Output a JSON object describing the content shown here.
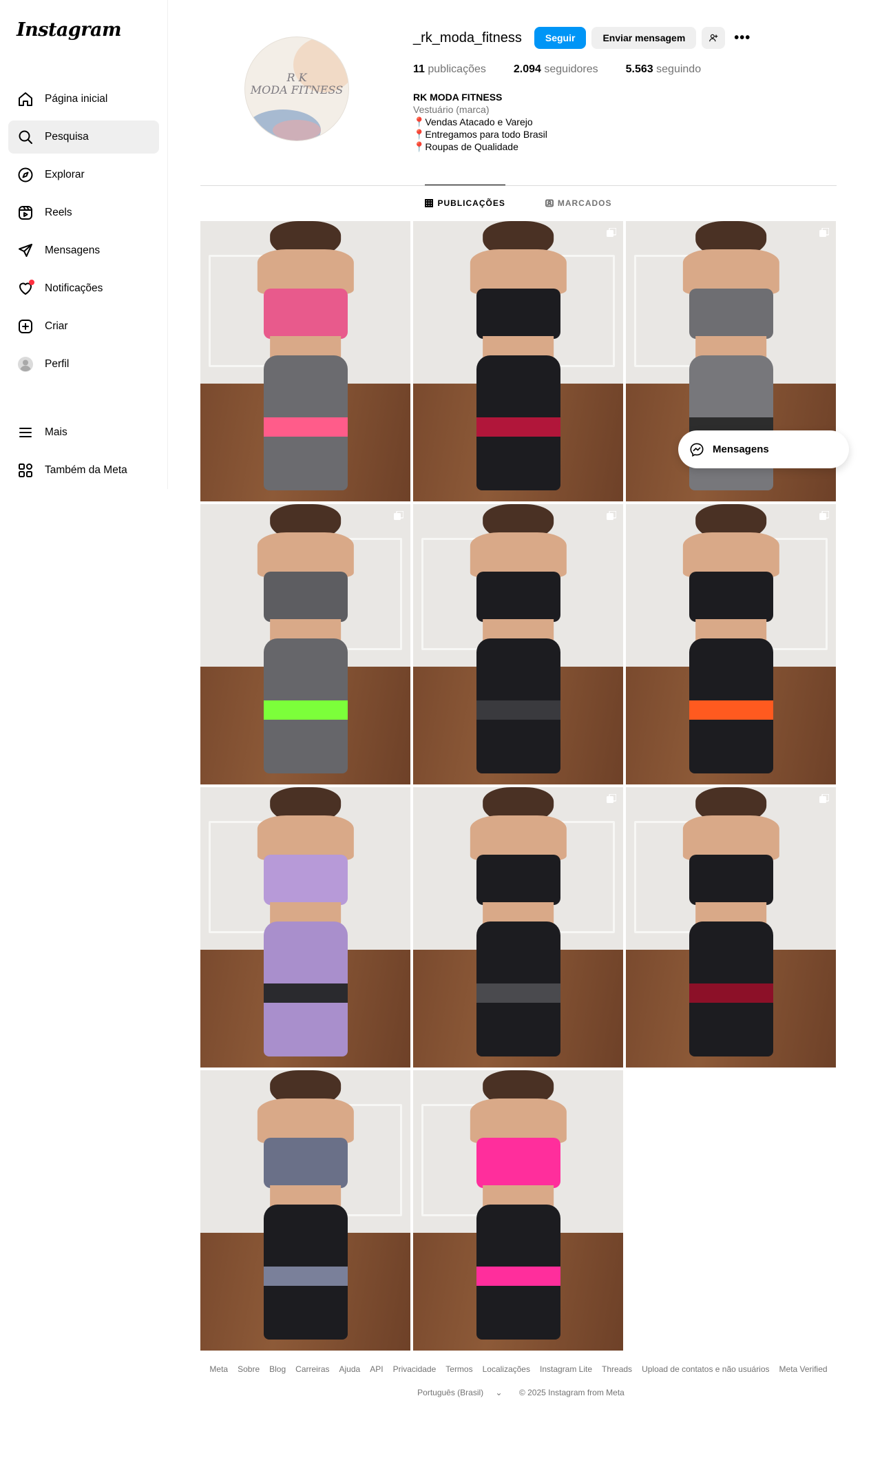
{
  "app": {
    "logo": "Instagram"
  },
  "sidebar": {
    "items": [
      {
        "label": "Página inicial",
        "icon": "home-icon"
      },
      {
        "label": "Pesquisa",
        "icon": "search-icon"
      },
      {
        "label": "Explorar",
        "icon": "compass-icon"
      },
      {
        "label": "Reels",
        "icon": "reels-icon"
      },
      {
        "label": "Mensagens",
        "icon": "send-icon"
      },
      {
        "label": "Notificações",
        "icon": "heart-icon"
      },
      {
        "label": "Criar",
        "icon": "plus-square-icon"
      },
      {
        "label": "Perfil",
        "icon": "avatar-icon"
      }
    ],
    "bottom": [
      {
        "label": "Mais",
        "icon": "menu-icon"
      },
      {
        "label": "Também da Meta",
        "icon": "meta-apps-icon"
      }
    ]
  },
  "profile": {
    "avatar_lettering": "R K MODA FITNESS",
    "username": "_rk_moda_fitness",
    "follow_label": "Seguir",
    "message_label": "Enviar mensagem",
    "stats": {
      "posts_count": "11",
      "posts_label": "publicações",
      "followers_count": "2.094",
      "followers_label": "seguidores",
      "following_count": "5.563",
      "following_label": "seguindo"
    },
    "bio": {
      "name": "RK MODA FITNESS",
      "category": "Vestuário (marca)",
      "lines": [
        "📍Vendas Atacado e Varejo",
        "📍Entregamos para todo Brasil",
        "📍Roupas de Qualidade"
      ]
    }
  },
  "tabs": {
    "posts": "PUBLICAÇÕES",
    "tagged": "MARCADOS"
  },
  "posts": [
    {
      "bra": "#e85a8c",
      "legs": "#6b6b6f",
      "band": "#ff5c8a",
      "multi": false
    },
    {
      "bra": "#1c1c20",
      "legs": "#1c1c20",
      "band": "#b1163a",
      "multi": true
    },
    {
      "bra": "#6e6e72",
      "legs": "#77777b",
      "band": "#2d2d2d",
      "multi": true
    },
    {
      "bra": "#5d5d61",
      "legs": "#66666a",
      "band": "#7cff3a",
      "multi": true
    },
    {
      "bra": "#1c1c20",
      "legs": "#1c1c20",
      "band": "#3a3a3e",
      "multi": true
    },
    {
      "bra": "#1c1c20",
      "legs": "#1c1c20",
      "band": "#ff5a1f",
      "multi": true
    },
    {
      "bra": "#b79ad8",
      "legs": "#a98fcc",
      "band": "#2a2a2e",
      "multi": false
    },
    {
      "bra": "#1c1c20",
      "legs": "#1c1c20",
      "band": "#4a4a4e",
      "multi": true
    },
    {
      "bra": "#1c1c20",
      "legs": "#1c1c20",
      "band": "#8c1028",
      "multi": true
    },
    {
      "bra": "#6a7088",
      "legs": "#1c1c20",
      "band": "#7a809a",
      "multi": false
    },
    {
      "bra": "#ff2e9c",
      "legs": "#1c1c20",
      "band": "#ff2e9c",
      "multi": false
    }
  ],
  "floating": {
    "label": "Mensagens"
  },
  "footer": {
    "links": [
      "Meta",
      "Sobre",
      "Blog",
      "Carreiras",
      "Ajuda",
      "API",
      "Privacidade",
      "Termos",
      "Localizações",
      "Instagram Lite",
      "Threads",
      "Upload de contatos e não usuários",
      "Meta Verified"
    ],
    "language": "Português (Brasil)",
    "copyright": "© 2025 Instagram from Meta"
  }
}
